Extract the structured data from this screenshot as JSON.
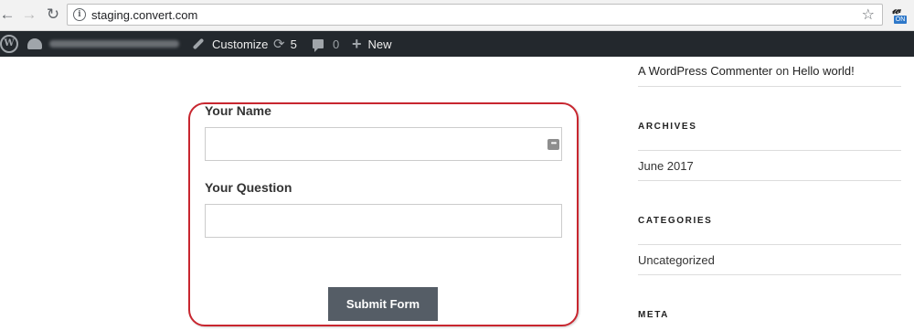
{
  "browser": {
    "url": "staging.convert.com",
    "extension_badge": "ON"
  },
  "adminbar": {
    "customize_label": "Customize",
    "updates_count": "5",
    "comments_count": "0",
    "new_label": "New"
  },
  "form": {
    "name_label": "Your Name",
    "name_value": "",
    "question_label": "Your Question",
    "question_value": "",
    "submit_label": "Submit Form",
    "highlight_color": "#c8262f"
  },
  "sidebar": {
    "recent_comment": {
      "author": "A WordPress Commenter",
      "connector": "on",
      "post": "Hello world!"
    },
    "archives_heading": "ARCHIVES",
    "archives": [
      "June 2017"
    ],
    "categories_heading": "CATEGORIES",
    "categories": [
      "Uncategorized"
    ],
    "meta_heading": "META"
  }
}
